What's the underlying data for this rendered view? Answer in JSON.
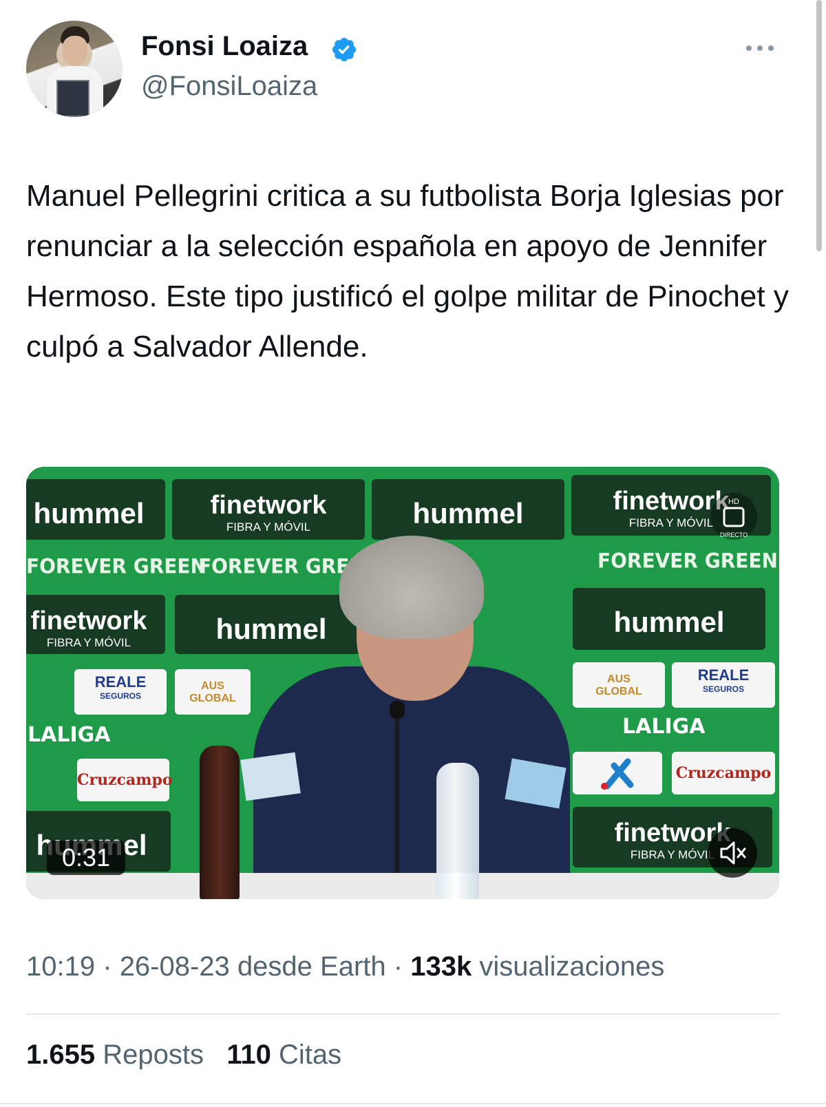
{
  "author": {
    "name": "Fonsi Loaiza",
    "handle": "@FonsiLoaiza",
    "verified_icon": "verified-badge-icon",
    "accent_color": "#1d9bf0"
  },
  "more_icon": "more-horizontal-icon",
  "tweet": {
    "text": "Manuel Pellegrini critica a su futbolista Borja Iglesias por renunciar a la selección española en apoyo de Jennifer Hermoso. Este tipo justificó el golpe militar de Pinochet y culpó a Salvador Allende."
  },
  "video": {
    "duration": "0:31",
    "mute_icon": "volume-muted-icon",
    "backdrop": {
      "hummel": "hummel",
      "finetwork": "finetwork",
      "finetwork_sub": "FIBRA Y MÓVIL",
      "forever_green": "FOREVER GREEN",
      "reale": "REALE",
      "reale_sub": "SEGUROS",
      "aus": "AUS",
      "global": "GLOBAL",
      "laliga": "LALIGA",
      "cruzcampo": "Cruzcampo",
      "hd": "HD",
      "directo": "DIRECTO"
    }
  },
  "meta": {
    "time": "10:19",
    "date": "26-08-23",
    "source": "desde Earth",
    "views_count": "133k",
    "views_label": "visualizaciones",
    "separator": "·"
  },
  "stats": {
    "reposts_count": "1.655",
    "reposts_label": "Reposts",
    "quotes_count": "110",
    "quotes_label": "Citas"
  }
}
